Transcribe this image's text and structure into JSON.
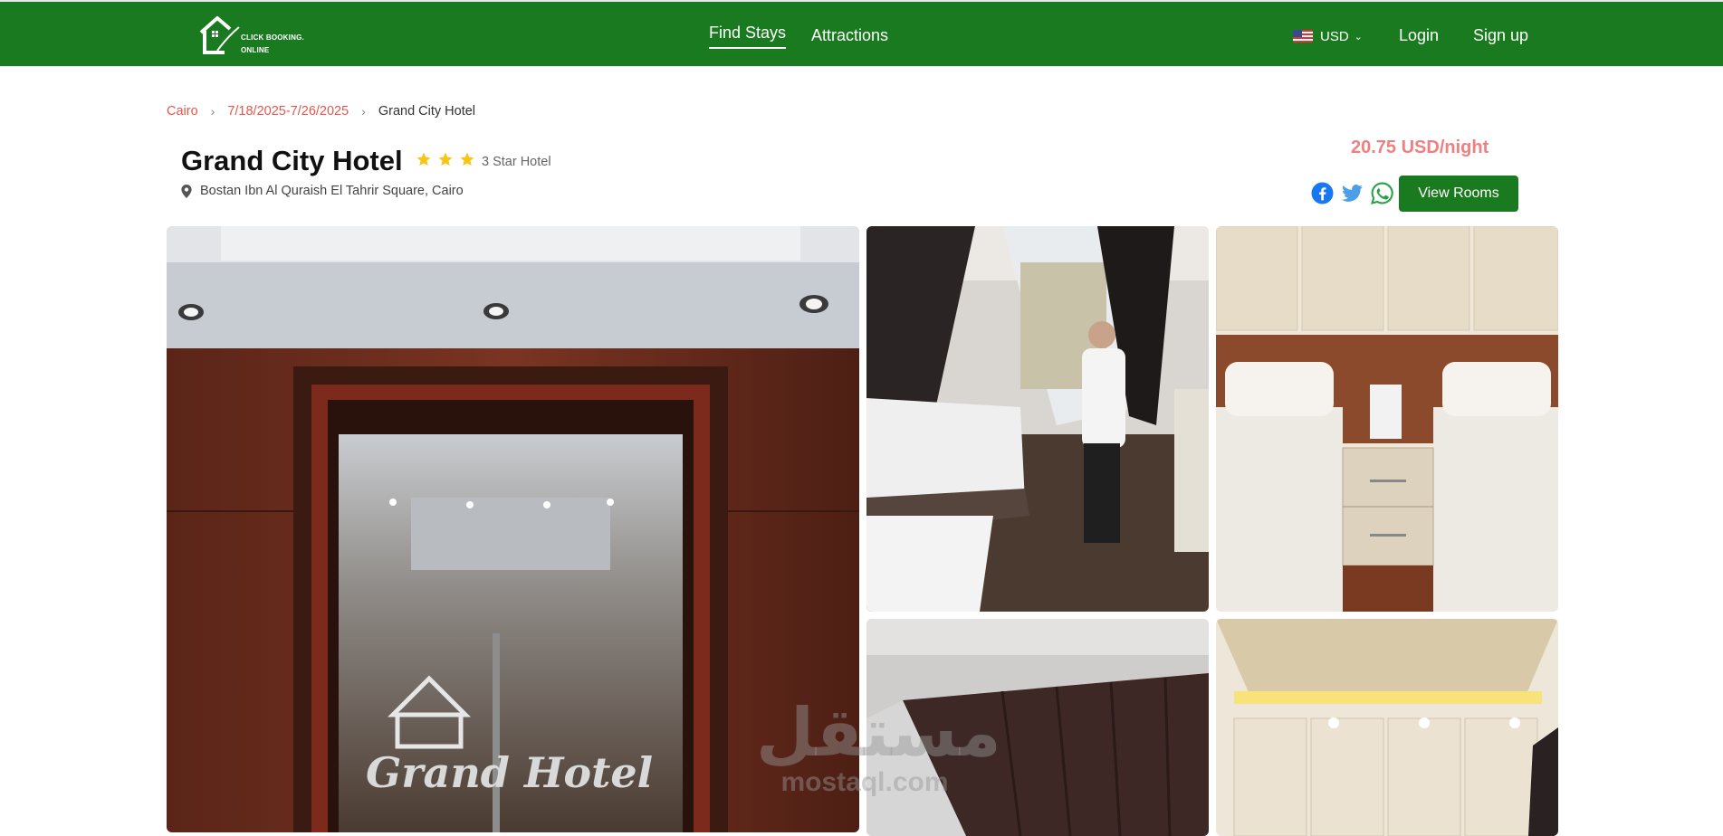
{
  "header": {
    "logo_line1": "CLICK BOOKING.",
    "logo_line2": "ONLINE",
    "nav": {
      "find_stays": "Find Stays",
      "attractions": "Attractions"
    },
    "currency": "USD",
    "login": "Login",
    "signup": "Sign up"
  },
  "breadcrumb": {
    "city": "Cairo",
    "dates": "7/18/2025-7/26/2025",
    "current": "Grand City Hotel"
  },
  "hotel": {
    "name": "Grand City Hotel",
    "star_count": 3,
    "star_label": "3 Star Hotel",
    "address": "Bostan Ibn Al Quraish El Tahrir Square, Cairo",
    "price": "20.75 USD/night",
    "view_rooms": "View Rooms"
  },
  "share": [
    "facebook-icon",
    "twitter-icon",
    "whatsapp-icon"
  ],
  "gallery": {
    "main_sign": "Grand Hotel"
  },
  "watermark": {
    "arabic": "مستقل",
    "latin": "mostaql.com"
  },
  "colors": {
    "brand_green": "#1a7a1f",
    "breadcrumb_link": "#e4574a",
    "price": "#f08080",
    "star": "#f5c518"
  }
}
